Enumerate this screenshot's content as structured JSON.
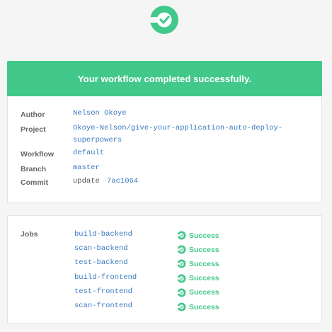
{
  "colors": {
    "success": "#42c88a",
    "link": "#3a7bbf",
    "label": "#666666",
    "background": "#f5f5f5"
  },
  "logo": {
    "icon": "circleci-success-icon"
  },
  "banner": {
    "message": "Your workflow completed successfully."
  },
  "details": {
    "author": {
      "label": "Author",
      "value": "Nelson Okoye"
    },
    "project": {
      "label": "Project",
      "value_line1": "Okoye-Nelson/give-your-application-auto-deploy-",
      "value_line2": "superpowers"
    },
    "workflow": {
      "label": "Workflow",
      "value": "default"
    },
    "branch": {
      "label": "Branch",
      "value": "master"
    },
    "commit": {
      "label": "Commit",
      "message": "update",
      "hash": "7ac1064"
    }
  },
  "jobs": {
    "label": "Jobs",
    "items": [
      {
        "name": "build-backend",
        "status": "Success",
        "icon": "success-icon"
      },
      {
        "name": "scan-backend",
        "status": "Success",
        "icon": "success-icon"
      },
      {
        "name": "test-backend",
        "status": "Success",
        "icon": "success-icon"
      },
      {
        "name": "build-frontend",
        "status": "Success",
        "icon": "success-icon"
      },
      {
        "name": "test-frontend",
        "status": "Success",
        "icon": "success-icon"
      },
      {
        "name": "scan-frontend",
        "status": "Success",
        "icon": "success-icon"
      }
    ]
  }
}
